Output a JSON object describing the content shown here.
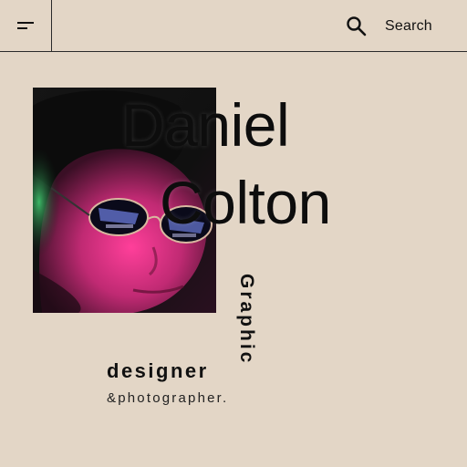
{
  "header": {
    "menu_icon": "menu-icon",
    "search_icon": "search-icon",
    "search_label": "Search"
  },
  "hero": {
    "photo_description_icon": "portrait-photo",
    "first_name": "Daniel",
    "last_name": "Colton",
    "vertical_word": "Graphic",
    "role": "designer",
    "subrole": "&photographer."
  },
  "colors": {
    "background": "#e3d6c6",
    "text": "#111111",
    "divider": "#2a2a2a"
  }
}
